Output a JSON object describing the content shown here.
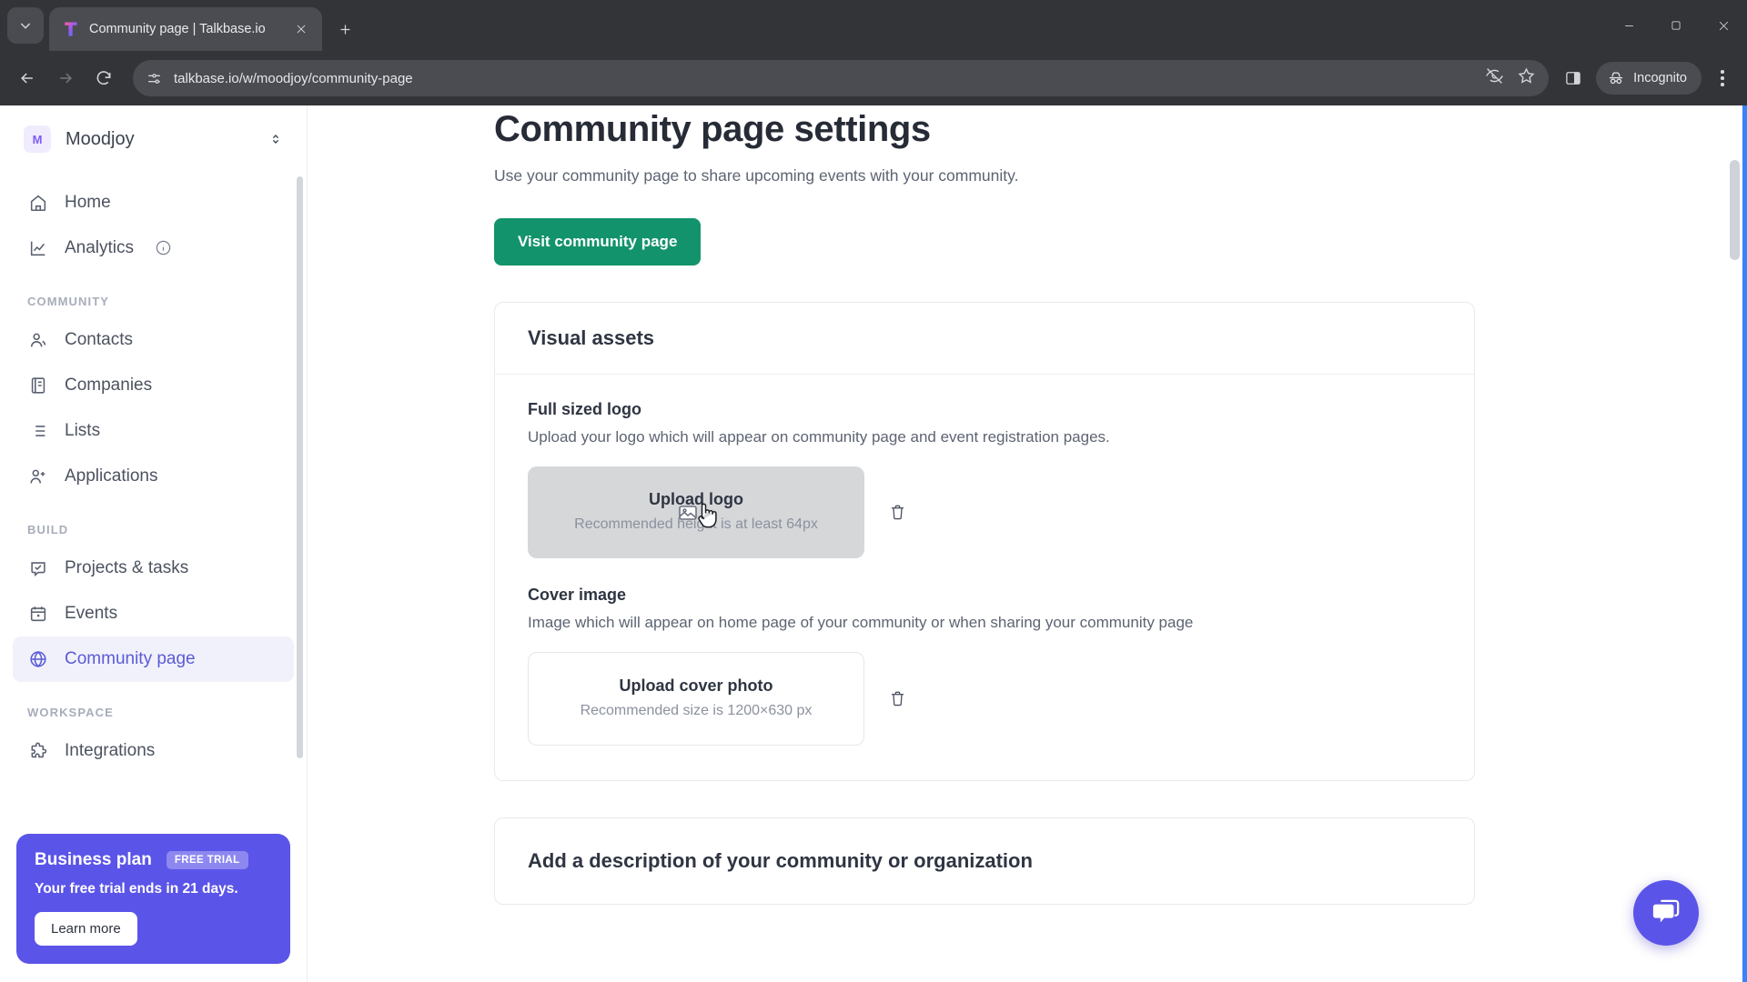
{
  "browser": {
    "tab": {
      "title": "Community page | Talkbase.io",
      "favicon": "talkbase-logo-icon"
    },
    "new_tab_label": "+",
    "url": "talkbase.io/w/moodjoy/community-page",
    "profile_label": "Incognito",
    "icons": {
      "tab_search": "chevron-down-icon",
      "close_tab": "close-icon",
      "back": "back-arrow-icon",
      "forward": "forward-arrow-icon",
      "reload": "reload-icon",
      "site_info": "site-settings-icon",
      "tracking": "eye-off-icon",
      "bookmark": "star-icon",
      "side_panel": "side-panel-icon",
      "incognito": "incognito-hat-icon",
      "menu": "three-dot-menu-icon",
      "minimize": "minimize-icon",
      "maximize": "maximize-icon",
      "window_close": "window-close-icon"
    }
  },
  "sidebar": {
    "workspace": {
      "initial": "M",
      "name": "Moodjoy",
      "switcher_icon": "chevron-up-down-icon"
    },
    "top_items": [
      {
        "label": "Home",
        "icon": "home-icon",
        "active": false
      },
      {
        "label": "Analytics",
        "icon": "analytics-chart-icon",
        "active": false,
        "info_icon": "info-icon"
      }
    ],
    "sections": [
      {
        "label": "COMMUNITY",
        "items": [
          {
            "label": "Contacts",
            "icon": "users-icon",
            "active": false
          },
          {
            "label": "Companies",
            "icon": "building-icon",
            "active": false
          },
          {
            "label": "Lists",
            "icon": "list-icon",
            "active": false
          },
          {
            "label": "Applications",
            "icon": "user-plus-icon",
            "active": false
          }
        ]
      },
      {
        "label": "BUILD",
        "items": [
          {
            "label": "Projects & tasks",
            "icon": "check-square-icon",
            "active": false
          },
          {
            "label": "Events",
            "icon": "calendar-icon",
            "active": false
          },
          {
            "label": "Community page",
            "icon": "globe-icon",
            "active": true
          }
        ]
      },
      {
        "label": "WORKSPACE",
        "items": [
          {
            "label": "Integrations",
            "icon": "puzzle-icon",
            "active": false
          }
        ]
      }
    ],
    "plan_card": {
      "title": "Business plan",
      "badge": "FREE TRIAL",
      "subtitle": "Your free trial ends in 21 days.",
      "button": "Learn more"
    }
  },
  "main": {
    "title": "Community page settings",
    "subtitle": "Use your community page to share upcoming events with your community.",
    "visit_button": "Visit community page",
    "visual_assets": {
      "heading": "Visual assets",
      "logo": {
        "label": "Full sized logo",
        "description": "Upload your logo which will appear on community page and event registration pages.",
        "dropzone_title": "Upload logo",
        "dropzone_hint": "Recommended height is at least 64px",
        "delete_icon": "trash-icon",
        "upload_icon": "image-upload-icon"
      },
      "cover": {
        "label": "Cover image",
        "description": "Image which will appear on home page of your community or when sharing your community page",
        "dropzone_title": "Upload cover photo",
        "dropzone_hint": "Recommended size is 1200×630 px",
        "delete_icon": "trash-icon"
      }
    },
    "description_card": {
      "heading": "Add a description of your community or organization"
    },
    "chat_fab_icon": "chat-bubble-icon"
  },
  "colors": {
    "brand_purple": "#5b54e8",
    "active_nav": "#5b5bd6",
    "green_button": "#13936b",
    "chrome_bg": "#333438",
    "focus_border": "#3b82f6"
  }
}
